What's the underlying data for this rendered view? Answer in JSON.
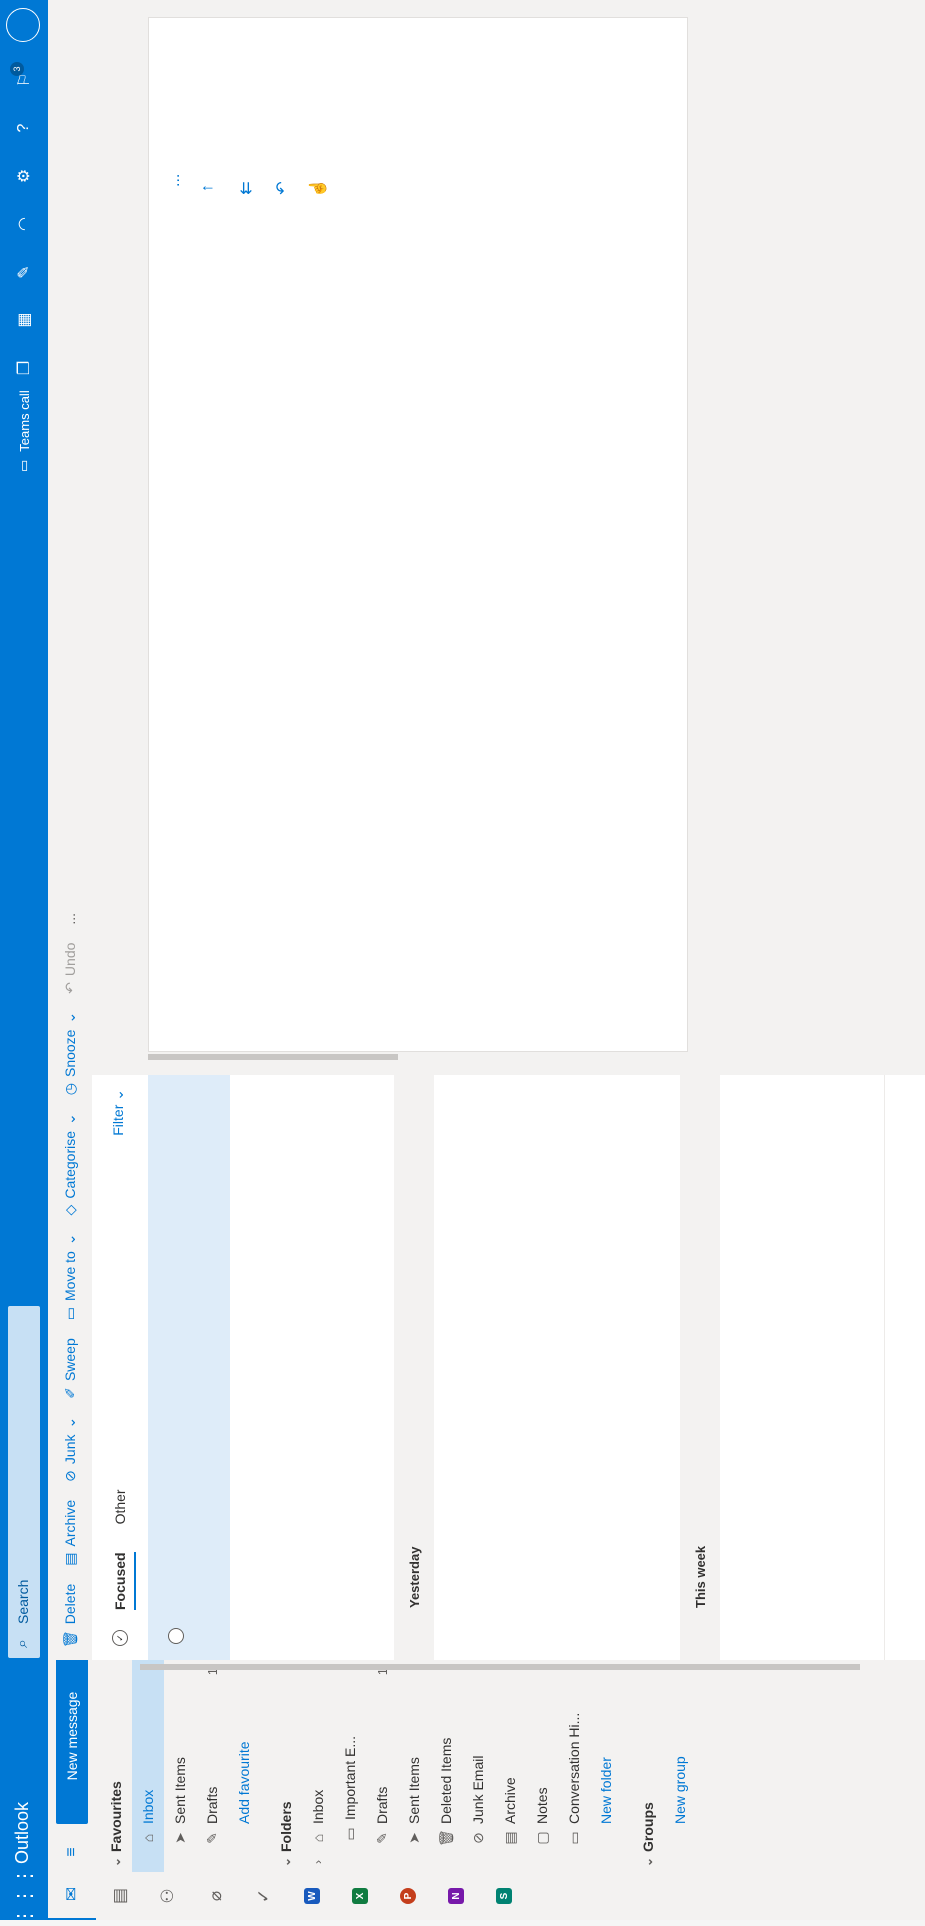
{
  "header": {
    "brand": "Outlook",
    "search_placeholder": "Search",
    "teams_call": "Teams call",
    "notifications_count": "3"
  },
  "rail": {
    "apps": [
      {
        "name": "Mail",
        "icon": "mail-icon"
      },
      {
        "name": "Calendar",
        "icon": "calendar-icon"
      },
      {
        "name": "People",
        "icon": "people-icon"
      },
      {
        "name": "Files",
        "icon": "paperclip-icon"
      },
      {
        "name": "To Do",
        "icon": "todo-icon"
      },
      {
        "name": "Word",
        "letter": "W",
        "color": "#185abd"
      },
      {
        "name": "Excel",
        "letter": "X",
        "color": "#107c41"
      },
      {
        "name": "PowerPoint",
        "letter": "P",
        "color": "#c43e1c"
      },
      {
        "name": "OneNote",
        "letter": "N",
        "color": "#7719aa"
      },
      {
        "name": "Sway",
        "letter": "S",
        "color": "#008272"
      }
    ]
  },
  "folders": {
    "new_message": "New message",
    "favourites_label": "Favourites",
    "favourites": [
      {
        "label": "Inbox",
        "count": ""
      },
      {
        "label": "Sent Items",
        "count": ""
      },
      {
        "label": "Drafts",
        "count": "1"
      }
    ],
    "add_favourite": "Add favourite",
    "folders_label": "Folders",
    "items": [
      {
        "label": "Inbox",
        "count": ""
      },
      {
        "label": "Important E...",
        "count": ""
      },
      {
        "label": "Drafts",
        "count": "1"
      },
      {
        "label": "Sent Items",
        "count": ""
      },
      {
        "label": "Deleted Items",
        "count": ""
      },
      {
        "label": "Junk Email",
        "count": ""
      },
      {
        "label": "Archive",
        "count": ""
      },
      {
        "label": "Notes",
        "count": ""
      },
      {
        "label": "Conversation Hi...",
        "count": ""
      }
    ],
    "new_folder": "New folder",
    "groups_label": "Groups",
    "new_group": "New group"
  },
  "commands": {
    "delete": "Delete",
    "archive": "Archive",
    "junk": "Junk",
    "sweep": "Sweep",
    "move_to": "Move to",
    "categorise": "Categorise",
    "snooze": "Snooze",
    "undo": "Undo",
    "more": "..."
  },
  "list": {
    "tab_focused": "Focused",
    "tab_other": "Other",
    "filter": "Filter",
    "group_yesterday": "Yesterday",
    "group_this_week": "This week"
  },
  "reading": {
    "more": "...",
    "actions": [
      "reply-icon",
      "reply-all-icon",
      "forward-icon",
      "more-icon"
    ]
  },
  "colors": {
    "accent": "#0078d4",
    "selected": "#c7e0f4"
  }
}
